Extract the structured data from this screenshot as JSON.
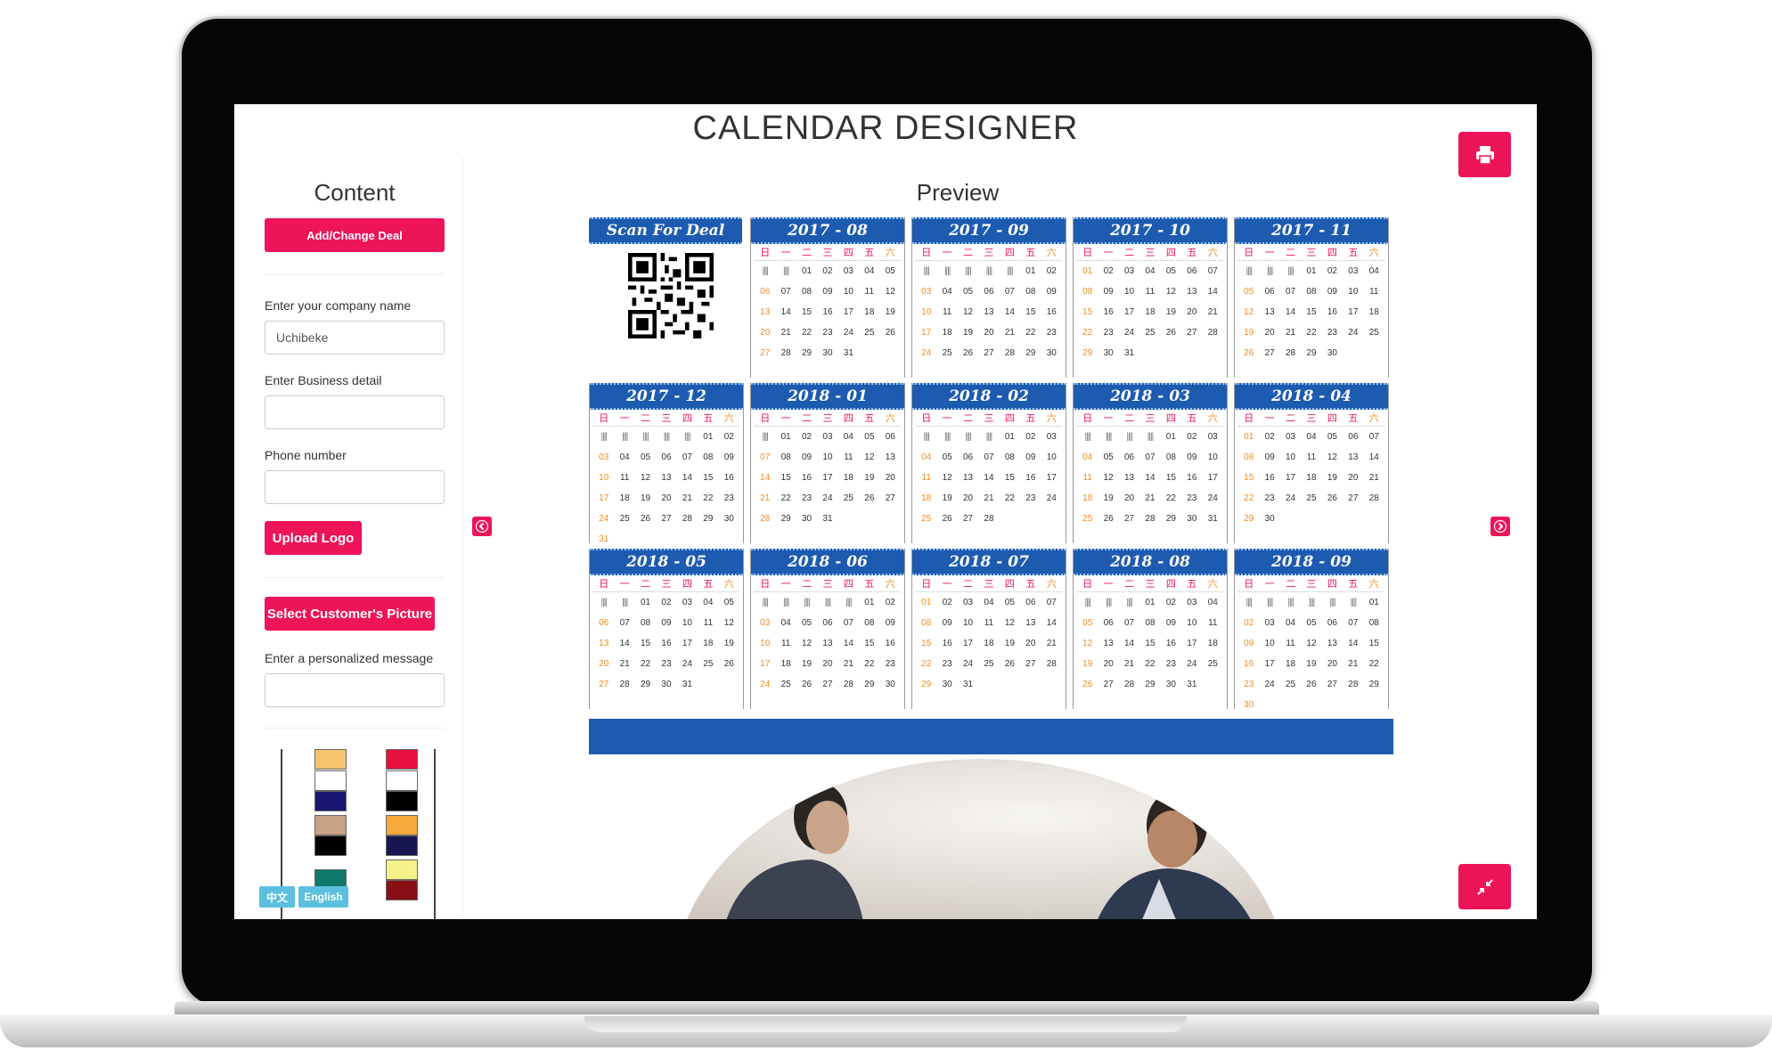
{
  "app": {
    "title": "CALENDAR DESIGNER"
  },
  "sidebar": {
    "heading": "Content",
    "add_deal_label": "Add/Change Deal",
    "company_label": "Enter your company name",
    "company_value": "Uchibeke",
    "business_label": "Enter Business detail",
    "business_value": "",
    "phone_label": "Phone number",
    "phone_value": "",
    "upload_logo_label": "Upload Logo",
    "customer_picture_label": "Select Customer's Picture",
    "message_label": "Enter a personalized message",
    "message_value": "",
    "swatches": [
      {
        "top": "#f6c46c",
        "bottom": null
      },
      {
        "top": "#e8103c",
        "bottom": null
      },
      {
        "top": "#ffffff",
        "bottom": "#181670"
      },
      {
        "top": "#ffffff",
        "bottom": "#000000"
      },
      {
        "top": "#c9a287",
        "bottom": "#000000"
      },
      {
        "top": "#f7a83a",
        "bottom": "#181650"
      },
      {
        "top": "#0f7a6b",
        "bottom": null
      },
      {
        "top": "#f5f28a",
        "bottom": "#8a0f16"
      }
    ]
  },
  "language": {
    "chinese_label": "中文",
    "english_label": "English"
  },
  "preview": {
    "heading": "Preview",
    "qr_title": "Scan For Deal",
    "weekday_labels": [
      "日",
      "一",
      "二",
      "三",
      "四",
      "五",
      "六"
    ],
    "weekday_colors": [
      "#ee1459",
      "#ee1459",
      "#ee1459",
      "#ee1459",
      "#ee1459",
      "#ee1459",
      "#f08c1e"
    ],
    "pad_glyph": "||||",
    "months": [
      {
        "title": "2017 - 08",
        "pad": 2,
        "days": 31
      },
      {
        "title": "2017 - 09",
        "pad": 5,
        "days": 30
      },
      {
        "title": "2017 - 10",
        "pad": 0,
        "days": 31
      },
      {
        "title": "2017 - 11",
        "pad": 3,
        "days": 30
      },
      {
        "title": "2017 - 12",
        "pad": 5,
        "days": 31
      },
      {
        "title": "2018 - 01",
        "pad": 1,
        "days": 31
      },
      {
        "title": "2018 - 02",
        "pad": 4,
        "days": 28
      },
      {
        "title": "2018 - 03",
        "pad": 4,
        "days": 31
      },
      {
        "title": "2018 - 04",
        "pad": 0,
        "days": 30
      },
      {
        "title": "2018 - 05",
        "pad": 2,
        "days": 31
      },
      {
        "title": "2018 - 06",
        "pad": 5,
        "days": 30
      },
      {
        "title": "2018 - 07",
        "pad": 0,
        "days": 31
      },
      {
        "title": "2018 - 08",
        "pad": 3,
        "days": 31
      },
      {
        "title": "2018 - 09",
        "pad": 6,
        "days": 30
      }
    ],
    "accent_color": "#1d5bb0",
    "button_color": "#ee1459"
  }
}
